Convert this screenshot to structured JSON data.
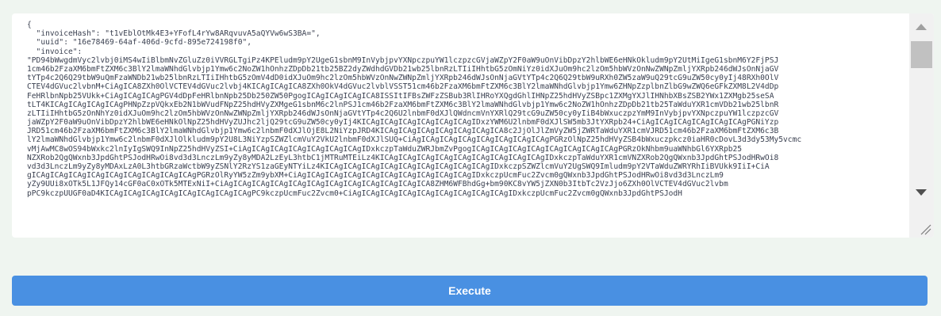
{
  "request_body": {
    "lines": [
      "{",
      "  \"invoiceHash\": \"t1vEblOtMk4E3+YFofL4rYw8ARqvuvA5aQYVw6wS3BA=\",",
      "  \"uuid\": \"16e78469-64af-406d-9cfd-895e724198f0\",",
      "  \"invoice\":",
      "\"PD94bWwgdmVyc2lvbj0iMS4wIiBlbmNvZGluZz0iVVRGLTgiPz4KPEludm9pY2UgeG1sbnM9InVybjpvYXNpczpuYW1lczpzcGVjaWZpY2F0aW9uOnVibDpzY2hlbWE6eHNkOkludm9pY2UtMiIgeG1sbnM6Y2FjPSJ",
      "1cm46b2FzaXM6bmFtZXM6c3BlY2lmaWNhdGlvbjp1Ymw6c2NoZW1hOnhzZDpDb21tb25BZ2dyZWdhdGVDb21wb25lbnRzLTIiIHhtbG5zOmNiYz0idXJuOm9hc2lzOm5hbWVzOnNwZWNpZmljYXRpb246dWJsOnNjaGV",
      "tYTp4c2Q6Q29tbW9uQmFzaWNDb21wb25lbnRzLTIiIHhtbG5zOmV4dD0idXJuOm9hc2lzOm5hbWVzOnNwZWNpZmljYXRpb246dWJsOnNjaGVtYTp4c2Q6Q29tbW9uRXh0ZW5zaW9uQ29tcG9uZW50cy0yIj48RXh0OlV",
      "CTEV4dGVuc2lvbnM+CiAgICA8ZXh0OlVCTEV4dGVuc2lvbj4KICAgICAgICA8ZXh0OkV4dGVuc2lvblVSST51cm46b2FzaXM6bmFtZXM6c3BlY2lmaWNhdGlvbjp1Ymw6ZHNpZzplbnZlbG9wZWQ6eGFkZXM8L2V4dDp",
      "FeHRlbnNpb25VUkk+CiAgICAgICAgPGV4dDpFeHRlbnNpb25Db250ZW50PgogICAgICAgICAgICA8ISSItIFBsZWFzZSBub3RlIHRoYXQgdGhlIHNpZ25hdHVyZSBpc1ZXMgYXJlIHNhbXBsZSB2YWx1ZXMgb25seSA",
      "tLT4KICAgICAgICAgICAgPHNpZzpVQkxEb2N1bWVudFNpZ25hdHVyZXMgeG1sbnM6c2lnPSJ1cm46b2FzaXM6bmFtZXM6c3BlY2lmaWNhdGlvbjp1Ymw6c2NoZW1hOnhzZDpDb21tb25TaWduYXR1cmVDb21wb25lbnR",
      "zLTIiIHhtbG5zOnNhYz0idXJuOm9hc2lzOm5hbWVzOnNwZWNpZmljYXRpb246dWJsOnNjaGVtYTp4c2Q6U2lnbmF0dXJlQWdncmVnYXRlQ29tcG9uZW50cy0yIiB4bWxuczpzYmM9InVybjpvYXNpczpuYW1lczpzcGV",
      "jaWZpY2F0aW9uOnVibDpzY2hlbWE6eHNkOlNpZ25hdHVyZUJhc2ljQ29tcG9uZW50cy0yIj4KICAgICAgICAgICAgICAgICAgIDxzYWM6U2lnbmF0dXJlSW5mb3JtYXRpb24+CiAgICAgICAgICAgICAgICAgPGNiYzp",
      "JRD51cm46b2FzaXM6bmFtZXM6c3BlY2lmaWNhdGlvbjp1Ymw6c2lnbmF0dXJlOjE8L2NiYzpJRD4KICAgICAgICAgICAgICAgICAgICA8c2JjOlJlZmVyZW5jZWRTaWduYXR1cmVJRD51cm46b2FzaXM6bmFtZXM6c3B",
      "lY2lmaWNhdGlvbjp1Ymw6c2lnbmF0dXJlOlkludm9pY2U8L3NiYzpSZWZlcmVuY2VkU2lnbmF0dXJlSUQ+CiAgICAgICAgICAgICAgICAgICAgICAgPGRzOlNpZ25hdHVyZSB4bWxuczpkcz0iaHR0cDovL3d3dy53My5vcmc",
      "vMjAwMC8wOS94bWxkc2lnIyIgSWQ9InNpZ25hdHVyZSI+CiAgICAgICAgICAgICAgICAgICAgIDxkczpTaWduZWRJbmZvPgogICAgICAgICAgICAgICAgICAgICAgICAgPGRzOkNhbm9uaWNhbGl6YXRpb25",
      "NZXRob2QgQWxnb3JpdGhtPSJodHRwOi8vd3d3LnczLm9yZy8yMDA2LzEyL3htbC1jMTRuMTEiLz4KICAgICAgICAgICAgICAgICAgICAgICAgICAgIDxkczpTaWduYXR1cmVNZXRob2QgQWxnb3JpdGhtPSJodHRwOi8",
      "vd3d3LnczLm9yZy8yMDAxLzA0L3htbGRzaWctbW9yZSNlY2RzYS1zaGEyNTYiLz4KICAgICAgICAgICAgICAgICAgICAgICAgICAgIDxkczpSZWZlcmVuY2UgSWQ9Imludm9pY2VTaWduZWRYRhIiBVUkk9IiI+CiA",
      "gICAgICAgICAgICAgICAgICAgICAgICAgICAgPGRzOlRyYW5zZm9ybXM+CiAgICAgICAgICAgICAgICAgICAgICAgICAgICAgIDxkczpUcmFuc2Zvcm0gQWxnb3JpdGhtPSJodHRwOi8vd3d3LnczLm9",
      "yZy9UUi8xOTk5L1JFQy14cGF0aC0xOTk5MTExNiI+CiAgICAgICAgICAgICAgICAgICAgICAgICAgICAgICAgICA8ZHM6WFBhdGg+bm90KC8vYW5jZXN0b3ItbTc2VzJjo6ZXh0OlVCTEV4dGVuc2lvbm",
      "pPC9kczpUUGF0aD4KICAgICAgICAgICAgICAgICAgICAgICAgPC9kczpUcmFuc2Zvcm0+CiAgICAgICAgICAgICAgICAgICAgICAgICAgIDxkczpUcmFuc2Zvcm0gQWxnb3JpdGhtPSJodH"
    ]
  },
  "execute_label": "Execute",
  "colors": {
    "background": "#eff5f0",
    "editor_bg": "#ffffff",
    "button_bg": "#4990e2",
    "button_text": "#ffffff"
  },
  "icons": {
    "scroll_up": "scroll-up-arrow-icon",
    "scroll_down": "scroll-down-arrow-icon",
    "resize": "resize-grip-icon"
  }
}
